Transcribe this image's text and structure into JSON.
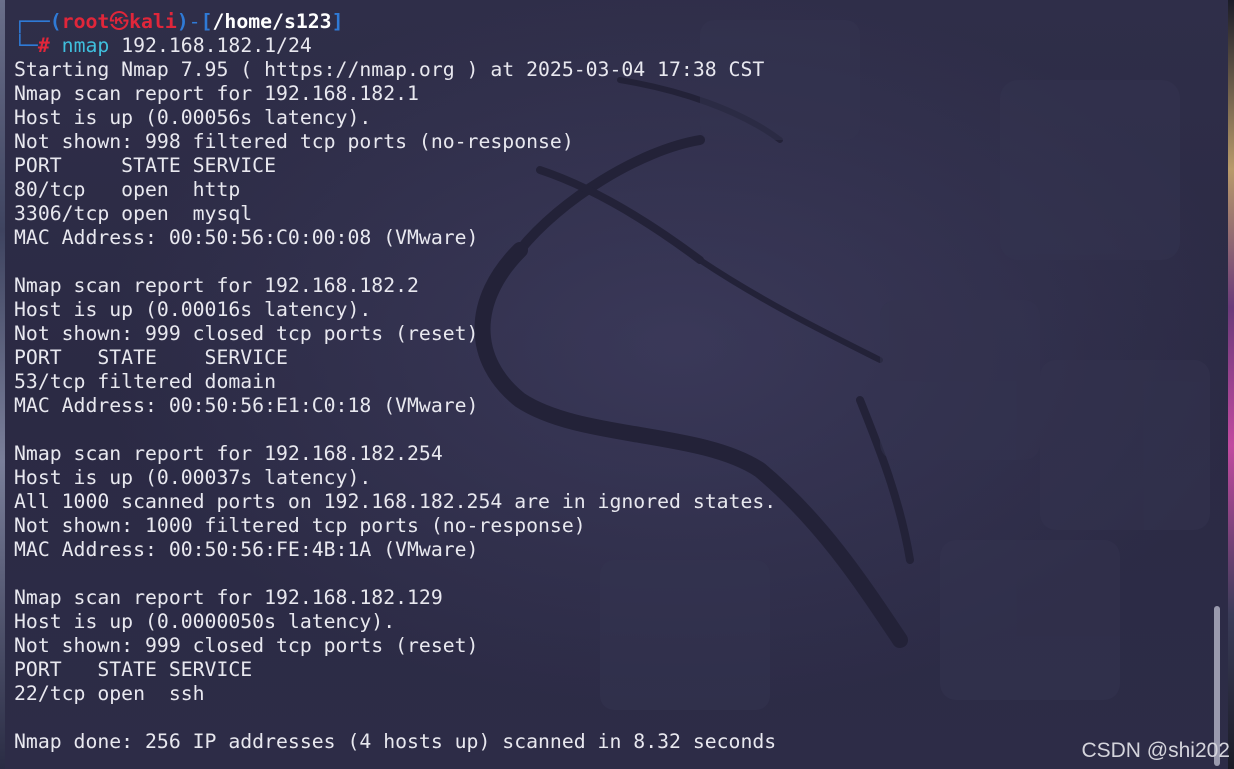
{
  "prompt": {
    "corner_top": "┌──",
    "corner_bottom": "└─",
    "open_paren": "(",
    "user": "root",
    "skull": "㉿",
    "host": "kali",
    "close_paren": ")",
    "dash": "-",
    "open_bracket": "[",
    "path": "/home/s123",
    "close_bracket": "]",
    "hash": "#",
    "command": "nmap",
    "arguments": "192.168.182.1/24"
  },
  "output_lines": [
    "Starting Nmap 7.95 ( https://nmap.org ) at 2025-03-04 17:38 CST",
    "Nmap scan report for 192.168.182.1",
    "Host is up (0.00056s latency).",
    "Not shown: 998 filtered tcp ports (no-response)",
    "PORT     STATE SERVICE",
    "80/tcp   open  http",
    "3306/tcp open  mysql",
    "MAC Address: 00:50:56:C0:00:08 (VMware)",
    "",
    "Nmap scan report for 192.168.182.2",
    "Host is up (0.00016s latency).",
    "Not shown: 999 closed tcp ports (reset)",
    "PORT   STATE    SERVICE",
    "53/tcp filtered domain",
    "MAC Address: 00:50:56:E1:C0:18 (VMware)",
    "",
    "Nmap scan report for 192.168.182.254",
    "Host is up (0.00037s latency).",
    "All 1000 scanned ports on 192.168.182.254 are in ignored states.",
    "Not shown: 1000 filtered tcp ports (no-response)",
    "MAC Address: 00:50:56:FE:4B:1A (VMware)",
    "",
    "Nmap scan report for 192.168.182.129",
    "Host is up (0.0000050s latency).",
    "Not shown: 999 closed tcp ports (reset)",
    "PORT   STATE SERVICE",
    "22/tcp open  ssh",
    "",
    "Nmap done: 256 IP addresses (4 hosts up) scanned in 8.32 seconds"
  ],
  "watermark": "CSDN @shi202",
  "colors": {
    "background": "#2c2b45",
    "prompt_frame": "#2f7ad6",
    "prompt_user": "#e0263a",
    "prompt_path": "#ffffff",
    "command": "#3fbfdc",
    "text": "#e8e8ef"
  },
  "icons": {
    "skull": "skull-icon",
    "wallpaper": "kali-dragon-logo"
  }
}
